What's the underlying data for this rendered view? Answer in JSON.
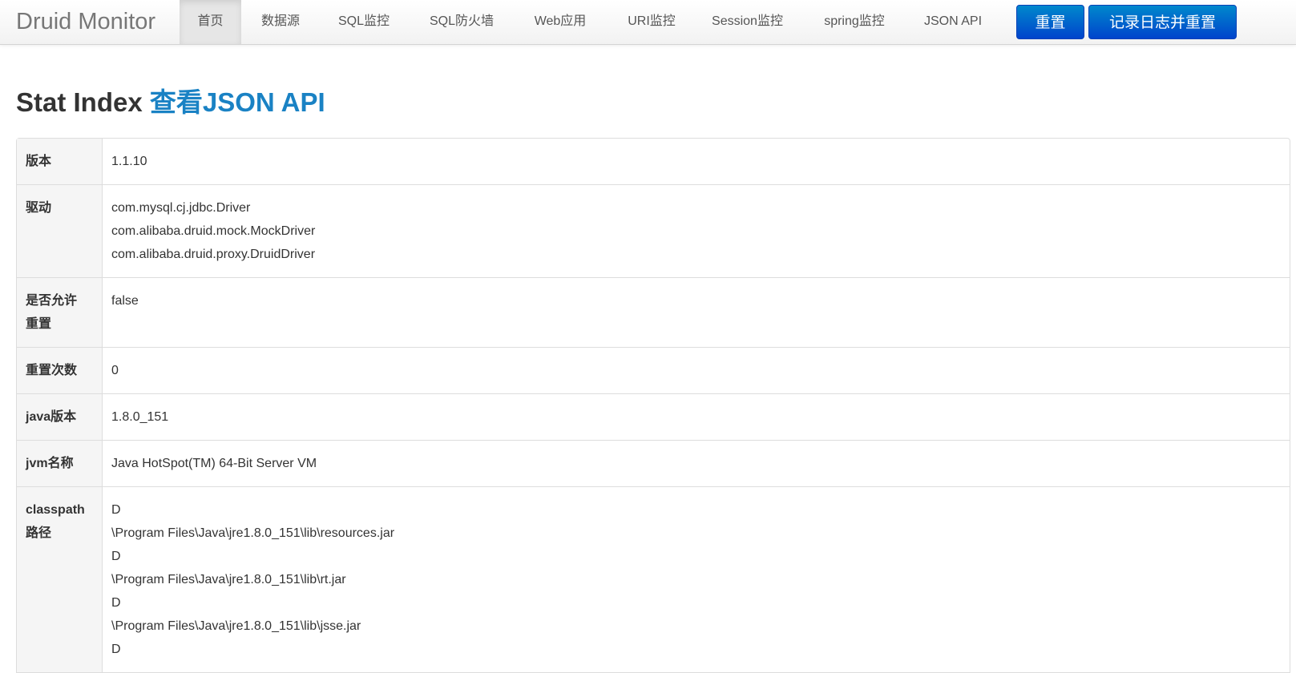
{
  "navbar": {
    "brand": "Druid Monitor",
    "tabs": [
      {
        "label": "首页"
      },
      {
        "label": "数据源"
      },
      {
        "label": "SQL监控"
      },
      {
        "label": "SQL防火墙"
      },
      {
        "label": "Web应用"
      },
      {
        "label": "URI监控"
      },
      {
        "label": "Session监控"
      },
      {
        "label": "spring监控"
      },
      {
        "label": "JSON API"
      }
    ],
    "active_tab": "首页",
    "reset_button": "重置",
    "log_reset_button": "记录日志并重置"
  },
  "heading": {
    "title": "Stat Index",
    "link": "查看JSON API"
  },
  "stats": {
    "version": {
      "key": "版本",
      "value": "1.1.10"
    },
    "drivers": {
      "key": "驱动",
      "values": [
        "com.mysql.cj.jdbc.Driver",
        "com.alibaba.druid.mock.MockDriver",
        "com.alibaba.druid.proxy.DruidDriver"
      ]
    },
    "reset_enable": {
      "key_line1": "是否允许",
      "key_line2": "重置",
      "value": "false"
    },
    "reset_count": {
      "key": "重置次数",
      "value": "0"
    },
    "java_version": {
      "key": "java版本",
      "value": "1.8.0_151"
    },
    "jvm_name": {
      "key": "jvm名称",
      "value": "Java HotSpot(TM) 64-Bit Server VM"
    },
    "classpath": {
      "key_line1": "classpath",
      "key_line2": "路径",
      "values": [
        "D",
        "\\Program Files\\Java\\jre1.8.0_151\\lib\\resources.jar",
        "D",
        "\\Program Files\\Java\\jre1.8.0_151\\lib\\rt.jar",
        "D",
        "\\Program Files\\Java\\jre1.8.0_151\\lib\\jsse.jar",
        "D"
      ]
    }
  },
  "colors": {
    "primary_button": "#0058cc",
    "link": "#1a82c4",
    "key_cell_bg": "#f5f5f5"
  }
}
